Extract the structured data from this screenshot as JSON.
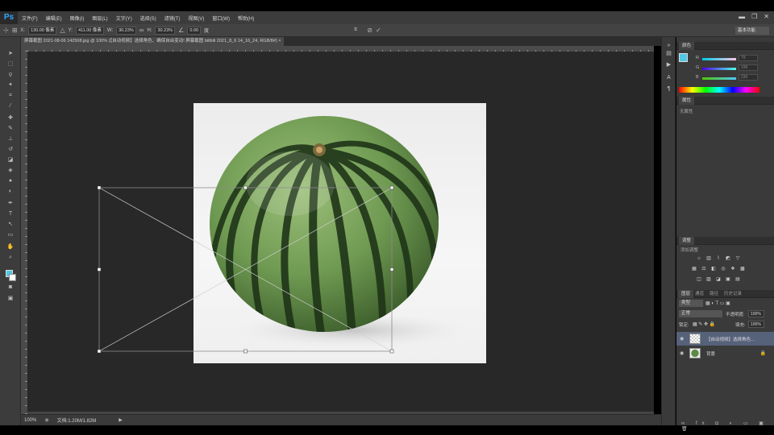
{
  "app": {
    "logo": "Ps",
    "menu": [
      "文件(F)",
      "编辑(E)",
      "图像(I)",
      "图层(L)",
      "文字(Y)",
      "选择(S)",
      "滤镜(T)",
      "视图(V)",
      "窗口(W)",
      "帮助(H)"
    ],
    "window_controls": [
      "▬",
      "❐",
      "✕"
    ]
  },
  "options_bar": {
    "x_label": "X:",
    "x_value": "130.00 像素",
    "y_label": "Y:",
    "y_value": "411.00 像素",
    "w_label": "W:",
    "w_value": "30.23%",
    "h_label": "H:",
    "h_value": "30.23%",
    "angle_value": "0.00",
    "angle_unit": "度",
    "interp_label": "插值:",
    "interp_value": "两次立方",
    "cancel_icon": "cancel-icon",
    "commit_icon": "commit-icon",
    "workspace": "基本功能"
  },
  "document_tab": {
    "label": "屏幕截图 2021-08-06 142508.jpg @ 100% (【自动视频】选择角色、确保自由变动!  屏幕截图 bilibili 2021_8_6 14_16_24, RGB/8#) ×"
  },
  "status_bar": {
    "zoom": "100%",
    "doc_info": "文档:1.20M/1.82M"
  },
  "color_panel": {
    "title": "颜色",
    "accent": "#4fc7e6",
    "r_label": "R",
    "r_value": "79",
    "g_label": "G",
    "g_value": "199",
    "b_label": "B",
    "b_value": "230"
  },
  "properties_panel": {
    "title": "属性",
    "empty_text": "无属性"
  },
  "adjustments_panel": {
    "title": "调整",
    "subtitle": "添加调整"
  },
  "layers_panel": {
    "tabs": [
      "图层",
      "通道",
      "路径",
      "历史记录"
    ],
    "kind_label": "类型",
    "blend_mode": "正常",
    "opacity_label": "不透明度:",
    "opacity_value": "100%",
    "lock_label": "锁定:",
    "fill_label": "填充:",
    "fill_value": "100%",
    "layers": [
      {
        "name": "【自动视频】选择角色…",
        "selected": true
      },
      {
        "name": "背景",
        "selected": false
      }
    ]
  }
}
